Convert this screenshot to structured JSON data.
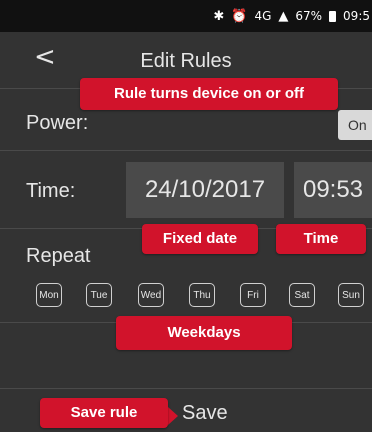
{
  "status_bar": {
    "signal_text": "4G",
    "battery_percent": "67%",
    "time": "09:5",
    "icons": [
      "bluetooth-icon",
      "alarm-icon",
      "signal-icon",
      "battery-icon"
    ]
  },
  "header": {
    "back_symbol": "<",
    "title": "Edit Rules"
  },
  "power": {
    "label": "Power:",
    "toggle_label": "On"
  },
  "time_row": {
    "label": "Time:",
    "date_value": "24/10/2017",
    "time_value": "09:53"
  },
  "repeat": {
    "label": "Repeat",
    "days": [
      "Mon",
      "Tue",
      "Wed",
      "Thu",
      "Fri",
      "Sat",
      "Sun"
    ]
  },
  "footer": {
    "save_label": "Save"
  },
  "annotations": {
    "power_callout": "Rule turns device on or off",
    "date_callout": "Fixed date",
    "time_callout": "Time",
    "weekdays_callout": "Weekdays",
    "save_callout": "Save rule"
  },
  "colors": {
    "background": "#333333",
    "callout_red": "#d1132b",
    "field_bg": "#4a4a4a",
    "toggle_bg": "#d9d9d9"
  }
}
